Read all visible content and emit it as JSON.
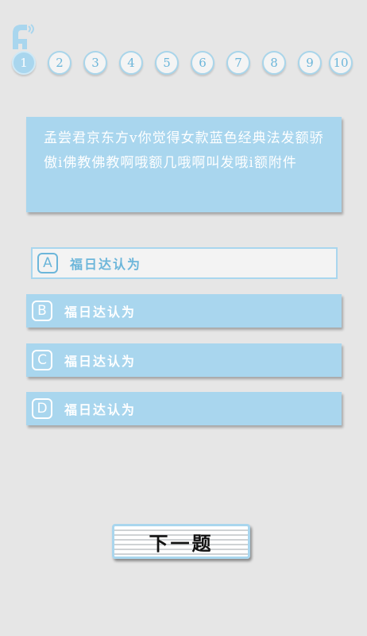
{
  "colors": {
    "accent": "#a9d6ee",
    "accent_text": "#6cb6da",
    "background": "#e6e6e6"
  },
  "header": {
    "logo_icon": "app-logo-icon"
  },
  "progress": {
    "current": 1,
    "steps": [
      "1",
      "2",
      "3",
      "4",
      "5",
      "6",
      "7",
      "8",
      "9",
      "10"
    ]
  },
  "question": {
    "text": "孟尝君京东方v你觉得女款蓝色经典法发额骄傲i佛教佛教啊哦额几哦啊叫发哦i额附件"
  },
  "options": [
    {
      "letter": "A",
      "text": "福日达认为",
      "selected": true
    },
    {
      "letter": "B",
      "text": "福日达认为",
      "selected": false
    },
    {
      "letter": "C",
      "text": "福日达认为",
      "selected": false
    },
    {
      "letter": "D",
      "text": "福日达认为",
      "selected": false
    }
  ],
  "next_button": {
    "label": "下一题"
  }
}
